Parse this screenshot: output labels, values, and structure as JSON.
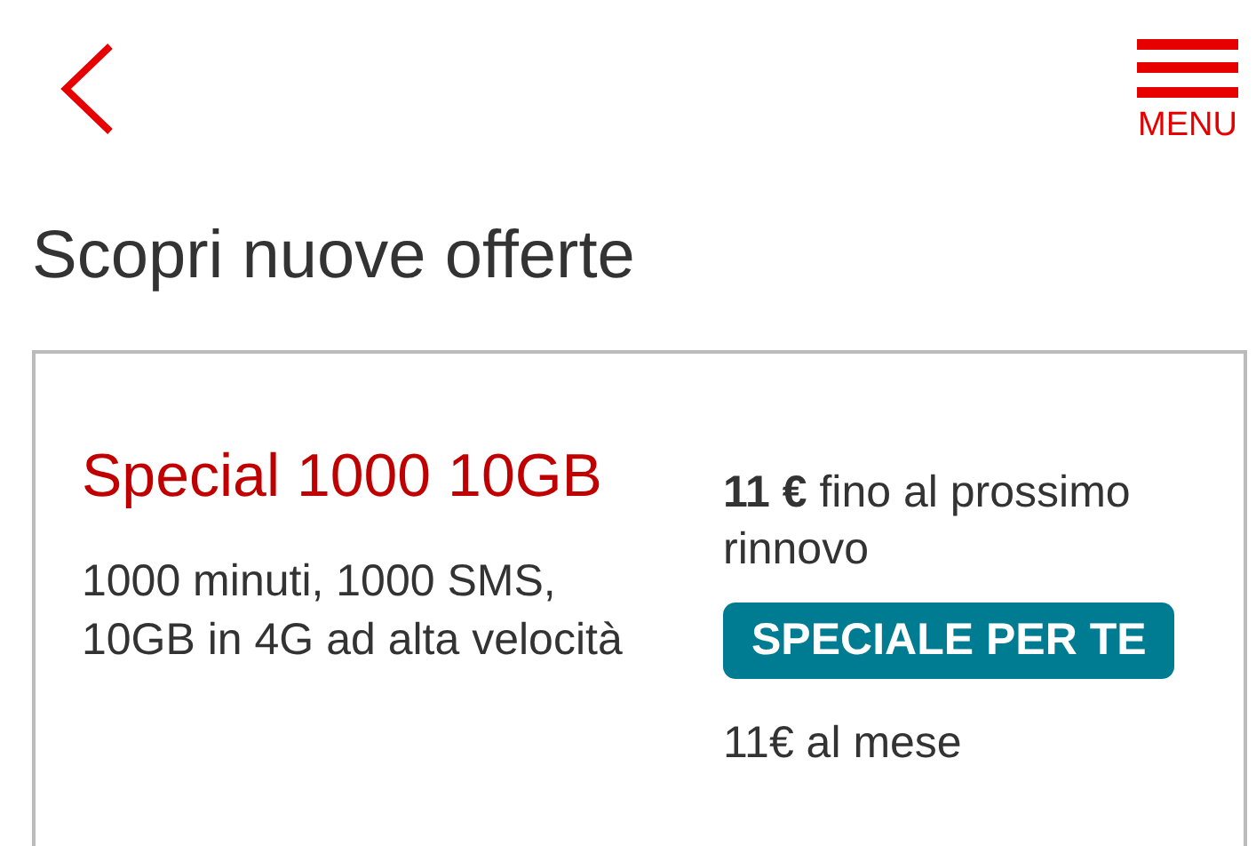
{
  "header": {
    "menu": {
      "label": "MENU"
    }
  },
  "title": "Scopri nuove offerte",
  "offer": {
    "name": "Special 1000 10GB",
    "description": "1000 minuti, 1000 SMS, 10GB in 4G ad alta velocità",
    "price": "**11 €** fino al prossimo rinnovo",
    "badge": "SPECIALE PER TE",
    "monthly": "11€ al mese"
  }
}
